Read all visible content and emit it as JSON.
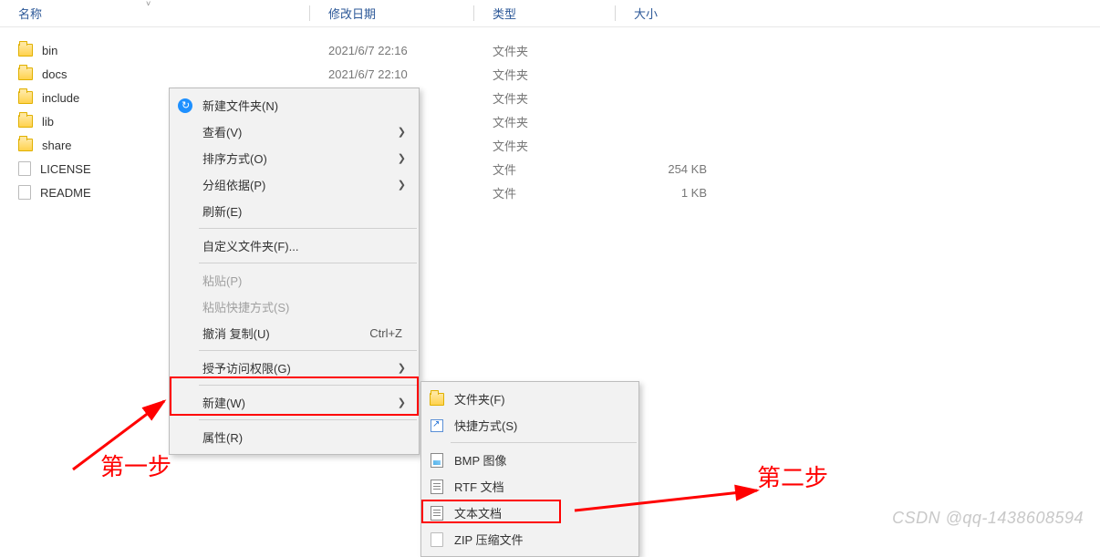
{
  "columns": {
    "name": "名称",
    "date": "修改日期",
    "type": "类型",
    "size": "大小"
  },
  "files": [
    {
      "name": "bin",
      "date": "2021/6/7 22:16",
      "type": "文件夹",
      "size": "",
      "icon": "folder"
    },
    {
      "name": "docs",
      "date": "2021/6/7 22:10",
      "type": "文件夹",
      "size": "",
      "icon": "folder"
    },
    {
      "name": "include",
      "date": "",
      "type": "文件夹",
      "size": "",
      "icon": "folder"
    },
    {
      "name": "lib",
      "date": "",
      "type": "文件夹",
      "size": "",
      "icon": "folder"
    },
    {
      "name": "share",
      "date": "",
      "type": "文件夹",
      "size": "",
      "icon": "folder"
    },
    {
      "name": "LICENSE",
      "date": "",
      "type": "文件",
      "size": "254 KB",
      "icon": "file"
    },
    {
      "name": "README",
      "date": "",
      "type": "文件",
      "size": "1 KB",
      "icon": "file"
    }
  ],
  "context_menu": {
    "new_folder": "新建文件夹(N)",
    "view": "查看(V)",
    "sort": "排序方式(O)",
    "group": "分组依据(P)",
    "refresh": "刷新(E)",
    "customize": "自定义文件夹(F)...",
    "paste": "粘贴(P)",
    "paste_shortcut": "粘贴快捷方式(S)",
    "undo_copy": "撤消 复制(U)",
    "undo_shortcut": "Ctrl+Z",
    "grant_access": "授予访问权限(G)",
    "new": "新建(W)",
    "properties": "属性(R)"
  },
  "submenu": {
    "folder": "文件夹(F)",
    "shortcut": "快捷方式(S)",
    "bmp": "BMP 图像",
    "rtf": "RTF 文档",
    "txt": "文本文档",
    "zip": "ZIP 压缩文件"
  },
  "annotations": {
    "step1": "第一步",
    "step2": "第二步"
  },
  "watermark": "CSDN @qq-1438608594"
}
